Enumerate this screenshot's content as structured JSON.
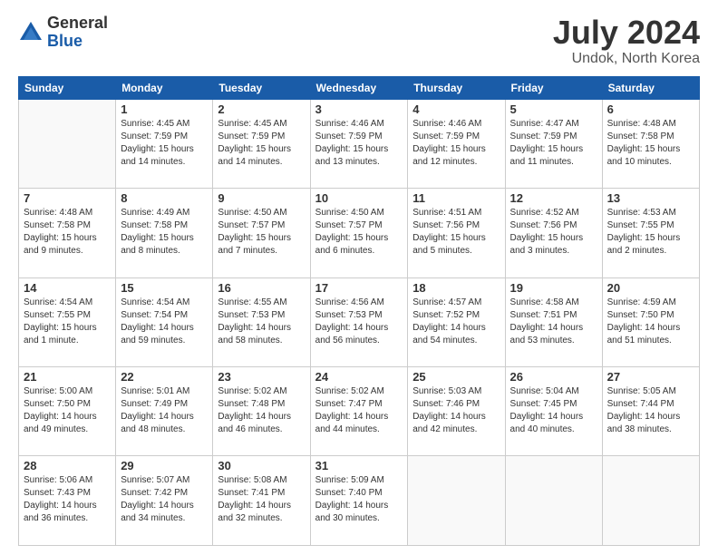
{
  "logo": {
    "general": "General",
    "blue": "Blue"
  },
  "header": {
    "month": "July 2024",
    "location": "Undok, North Korea"
  },
  "weekdays": [
    "Sunday",
    "Monday",
    "Tuesday",
    "Wednesday",
    "Thursday",
    "Friday",
    "Saturday"
  ],
  "weeks": [
    [
      {
        "day": "",
        "sunrise": "",
        "sunset": "",
        "daylight": "",
        "empty": true
      },
      {
        "day": "1",
        "sunrise": "Sunrise: 4:45 AM",
        "sunset": "Sunset: 7:59 PM",
        "daylight": "Daylight: 15 hours and 14 minutes."
      },
      {
        "day": "2",
        "sunrise": "Sunrise: 4:45 AM",
        "sunset": "Sunset: 7:59 PM",
        "daylight": "Daylight: 15 hours and 14 minutes."
      },
      {
        "day": "3",
        "sunrise": "Sunrise: 4:46 AM",
        "sunset": "Sunset: 7:59 PM",
        "daylight": "Daylight: 15 hours and 13 minutes."
      },
      {
        "day": "4",
        "sunrise": "Sunrise: 4:46 AM",
        "sunset": "Sunset: 7:59 PM",
        "daylight": "Daylight: 15 hours and 12 minutes."
      },
      {
        "day": "5",
        "sunrise": "Sunrise: 4:47 AM",
        "sunset": "Sunset: 7:59 PM",
        "daylight": "Daylight: 15 hours and 11 minutes."
      },
      {
        "day": "6",
        "sunrise": "Sunrise: 4:48 AM",
        "sunset": "Sunset: 7:58 PM",
        "daylight": "Daylight: 15 hours and 10 minutes."
      }
    ],
    [
      {
        "day": "7",
        "sunrise": "Sunrise: 4:48 AM",
        "sunset": "Sunset: 7:58 PM",
        "daylight": "Daylight: 15 hours and 9 minutes."
      },
      {
        "day": "8",
        "sunrise": "Sunrise: 4:49 AM",
        "sunset": "Sunset: 7:58 PM",
        "daylight": "Daylight: 15 hours and 8 minutes."
      },
      {
        "day": "9",
        "sunrise": "Sunrise: 4:50 AM",
        "sunset": "Sunset: 7:57 PM",
        "daylight": "Daylight: 15 hours and 7 minutes."
      },
      {
        "day": "10",
        "sunrise": "Sunrise: 4:50 AM",
        "sunset": "Sunset: 7:57 PM",
        "daylight": "Daylight: 15 hours and 6 minutes."
      },
      {
        "day": "11",
        "sunrise": "Sunrise: 4:51 AM",
        "sunset": "Sunset: 7:56 PM",
        "daylight": "Daylight: 15 hours and 5 minutes."
      },
      {
        "day": "12",
        "sunrise": "Sunrise: 4:52 AM",
        "sunset": "Sunset: 7:56 PM",
        "daylight": "Daylight: 15 hours and 3 minutes."
      },
      {
        "day": "13",
        "sunrise": "Sunrise: 4:53 AM",
        "sunset": "Sunset: 7:55 PM",
        "daylight": "Daylight: 15 hours and 2 minutes."
      }
    ],
    [
      {
        "day": "14",
        "sunrise": "Sunrise: 4:54 AM",
        "sunset": "Sunset: 7:55 PM",
        "daylight": "Daylight: 15 hours and 1 minute."
      },
      {
        "day": "15",
        "sunrise": "Sunrise: 4:54 AM",
        "sunset": "Sunset: 7:54 PM",
        "daylight": "Daylight: 14 hours and 59 minutes."
      },
      {
        "day": "16",
        "sunrise": "Sunrise: 4:55 AM",
        "sunset": "Sunset: 7:53 PM",
        "daylight": "Daylight: 14 hours and 58 minutes."
      },
      {
        "day": "17",
        "sunrise": "Sunrise: 4:56 AM",
        "sunset": "Sunset: 7:53 PM",
        "daylight": "Daylight: 14 hours and 56 minutes."
      },
      {
        "day": "18",
        "sunrise": "Sunrise: 4:57 AM",
        "sunset": "Sunset: 7:52 PM",
        "daylight": "Daylight: 14 hours and 54 minutes."
      },
      {
        "day": "19",
        "sunrise": "Sunrise: 4:58 AM",
        "sunset": "Sunset: 7:51 PM",
        "daylight": "Daylight: 14 hours and 53 minutes."
      },
      {
        "day": "20",
        "sunrise": "Sunrise: 4:59 AM",
        "sunset": "Sunset: 7:50 PM",
        "daylight": "Daylight: 14 hours and 51 minutes."
      }
    ],
    [
      {
        "day": "21",
        "sunrise": "Sunrise: 5:00 AM",
        "sunset": "Sunset: 7:50 PM",
        "daylight": "Daylight: 14 hours and 49 minutes."
      },
      {
        "day": "22",
        "sunrise": "Sunrise: 5:01 AM",
        "sunset": "Sunset: 7:49 PM",
        "daylight": "Daylight: 14 hours and 48 minutes."
      },
      {
        "day": "23",
        "sunrise": "Sunrise: 5:02 AM",
        "sunset": "Sunset: 7:48 PM",
        "daylight": "Daylight: 14 hours and 46 minutes."
      },
      {
        "day": "24",
        "sunrise": "Sunrise: 5:02 AM",
        "sunset": "Sunset: 7:47 PM",
        "daylight": "Daylight: 14 hours and 44 minutes."
      },
      {
        "day": "25",
        "sunrise": "Sunrise: 5:03 AM",
        "sunset": "Sunset: 7:46 PM",
        "daylight": "Daylight: 14 hours and 42 minutes."
      },
      {
        "day": "26",
        "sunrise": "Sunrise: 5:04 AM",
        "sunset": "Sunset: 7:45 PM",
        "daylight": "Daylight: 14 hours and 40 minutes."
      },
      {
        "day": "27",
        "sunrise": "Sunrise: 5:05 AM",
        "sunset": "Sunset: 7:44 PM",
        "daylight": "Daylight: 14 hours and 38 minutes."
      }
    ],
    [
      {
        "day": "28",
        "sunrise": "Sunrise: 5:06 AM",
        "sunset": "Sunset: 7:43 PM",
        "daylight": "Daylight: 14 hours and 36 minutes."
      },
      {
        "day": "29",
        "sunrise": "Sunrise: 5:07 AM",
        "sunset": "Sunset: 7:42 PM",
        "daylight": "Daylight: 14 hours and 34 minutes."
      },
      {
        "day": "30",
        "sunrise": "Sunrise: 5:08 AM",
        "sunset": "Sunset: 7:41 PM",
        "daylight": "Daylight: 14 hours and 32 minutes."
      },
      {
        "day": "31",
        "sunrise": "Sunrise: 5:09 AM",
        "sunset": "Sunset: 7:40 PM",
        "daylight": "Daylight: 14 hours and 30 minutes."
      },
      {
        "day": "",
        "sunrise": "",
        "sunset": "",
        "daylight": "",
        "empty": true
      },
      {
        "day": "",
        "sunrise": "",
        "sunset": "",
        "daylight": "",
        "empty": true
      },
      {
        "day": "",
        "sunrise": "",
        "sunset": "",
        "daylight": "",
        "empty": true
      }
    ]
  ]
}
